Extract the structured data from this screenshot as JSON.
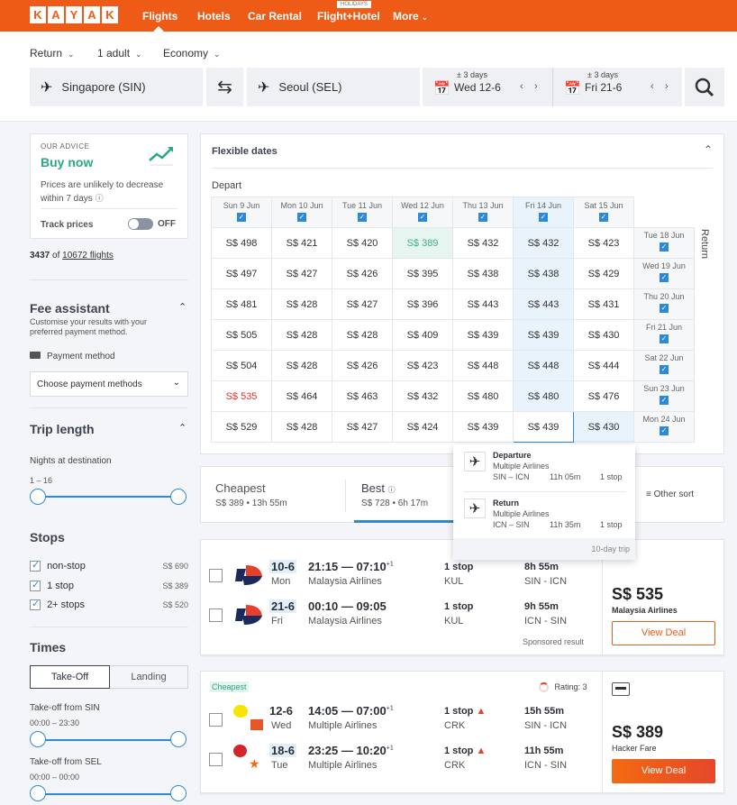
{
  "brand": {
    "letters": [
      "K",
      "A",
      "Y",
      "A",
      "K"
    ],
    "accent": "#ee5b16"
  },
  "nav": {
    "items": [
      "Flights",
      "Hotels",
      "Car Rental",
      "Flight+Hotel",
      "More"
    ],
    "holidays_badge": "HOLIDAYS",
    "active": "Flights"
  },
  "search": {
    "trip_type": "Return",
    "travellers": "1 adult",
    "cabin": "Economy",
    "origin": "Singapore (SIN)",
    "destination": "Seoul (SEL)",
    "depart_flex": "± 3 days",
    "depart_date": "Wed 12-6",
    "return_flex": "± 3 days",
    "return_date": "Fri 21-6"
  },
  "advice": {
    "label": "OUR ADVICE",
    "title": "Buy now",
    "text": "Prices are unlikely to decrease within 7 days",
    "track_label": "Track prices",
    "toggle_state": "OFF"
  },
  "results_count": {
    "shown": "3437",
    "of": "of",
    "total": "10672 flights"
  },
  "fee_assistant": {
    "title": "Fee assistant",
    "subtitle": "Customise your results with your preferred payment method.",
    "payment_label": "Payment method",
    "select_value": "Choose payment methods"
  },
  "trip_length": {
    "title": "Trip length",
    "label": "Nights at destination",
    "range": "1 – 16"
  },
  "stops": {
    "title": "Stops",
    "items": [
      {
        "label": "non-stop",
        "price": "S$ 690",
        "checked": true
      },
      {
        "label": "1 stop",
        "price": "S$ 389",
        "checked": true
      },
      {
        "label": "2+ stops",
        "price": "S$ 520",
        "checked": true
      }
    ]
  },
  "times": {
    "title": "Times",
    "tabs": [
      "Take-Off",
      "Landing"
    ],
    "active_tab": "Take-Off",
    "from_sin": {
      "label": "Take-off from SIN",
      "range": "00:00 – 23:30"
    },
    "from_sel": {
      "label": "Take-off from SEL",
      "range": "00:00 – 00:00"
    }
  },
  "flex": {
    "title": "Flexible dates",
    "depart_label": "Depart",
    "return_label": "Return",
    "depart_dates": [
      "Sun 9 Jun",
      "Mon 10 Jun",
      "Tue 11 Jun",
      "Wed 12 Jun",
      "Thu 13 Jun",
      "Fri 14 Jun",
      "Sat 15 Jun"
    ],
    "return_dates": [
      "Tue 18 Jun",
      "Wed 19 Jun",
      "Thu 20 Jun",
      "Fri 21 Jun",
      "Sat 22 Jun",
      "Sun 23 Jun",
      "Mon 24 Jun"
    ],
    "prices": [
      [
        "S$ 498",
        "S$ 421",
        "S$ 420",
        "S$ 389",
        "S$ 432",
        "S$ 432",
        "S$ 423"
      ],
      [
        "S$ 497",
        "S$ 427",
        "S$ 426",
        "S$ 395",
        "S$ 438",
        "S$ 438",
        "S$ 429"
      ],
      [
        "S$ 481",
        "S$ 428",
        "S$ 427",
        "S$ 396",
        "S$ 443",
        "S$ 443",
        "S$ 431"
      ],
      [
        "S$ 505",
        "S$ 428",
        "S$ 428",
        "S$ 409",
        "S$ 439",
        "S$ 439",
        "S$ 430"
      ],
      [
        "S$ 504",
        "S$ 428",
        "S$ 426",
        "S$ 423",
        "S$ 448",
        "S$ 448",
        "S$ 444"
      ],
      [
        "S$ 535",
        "S$ 464",
        "S$ 463",
        "S$ 432",
        "S$ 480",
        "S$ 480",
        "S$ 476"
      ],
      [
        "S$ 529",
        "S$ 428",
        "S$ 427",
        "S$ 424",
        "S$ 439",
        "S$ 439",
        "S$ 430"
      ]
    ]
  },
  "popup": {
    "departure": {
      "title": "Departure",
      "airline": "Multiple Airlines",
      "route": "SIN – ICN",
      "duration": "11h 05m",
      "stops": "1 stop"
    },
    "return": {
      "title": "Return",
      "airline": "Multiple Airlines",
      "route": "ICN – SIN",
      "duration": "11h 35m",
      "stops": "1 stop"
    },
    "footer": "10-day trip"
  },
  "sort": {
    "cheapest": {
      "label": "Cheapest",
      "detail": "S$ 389 • 13h 55m"
    },
    "best": {
      "label": "Best",
      "detail": "S$ 728 • 6h 17m"
    },
    "other": "Other sort"
  },
  "results": [
    {
      "legs": [
        {
          "date": "10-6",
          "day": "Mon",
          "times": "21:15 — 07:10",
          "plus": "+1",
          "airline": "Malaysia Airlines",
          "stops": "1 stop",
          "via": "KUL",
          "duration": "8h 55m",
          "route": "SIN - ICN"
        },
        {
          "date": "21-6",
          "day": "Fri",
          "times": "00:10 — 09:05",
          "plus": "",
          "airline": "Malaysia Airlines",
          "stops": "1 stop",
          "via": "KUL",
          "duration": "9h 55m",
          "route": "ICN - SIN"
        }
      ],
      "sponsored": "Sponsored result",
      "price": "S$ 535",
      "provider": "Malaysia Airlines",
      "cta": "View Deal"
    },
    {
      "badge": "Cheapest",
      "rating_label": "Rating:",
      "rating": "3",
      "legs": [
        {
          "date": "12-6",
          "day": "Wed",
          "times": "14:05 — 07:00",
          "plus": "+1",
          "airline": "Multiple Airlines",
          "stops": "1 stop",
          "via": "CRK",
          "duration": "15h 55m",
          "route": "SIN - ICN"
        },
        {
          "date": "18-6",
          "day": "Tue",
          "times": "23:25 — 10:20",
          "plus": "+1",
          "airline": "Multiple Airlines",
          "stops": "1 stop",
          "via": "CRK",
          "duration": "11h 55m",
          "route": "ICN - SIN"
        }
      ],
      "price": "S$ 389",
      "provider": "Hacker Fare",
      "cta": "View Deal"
    }
  ]
}
